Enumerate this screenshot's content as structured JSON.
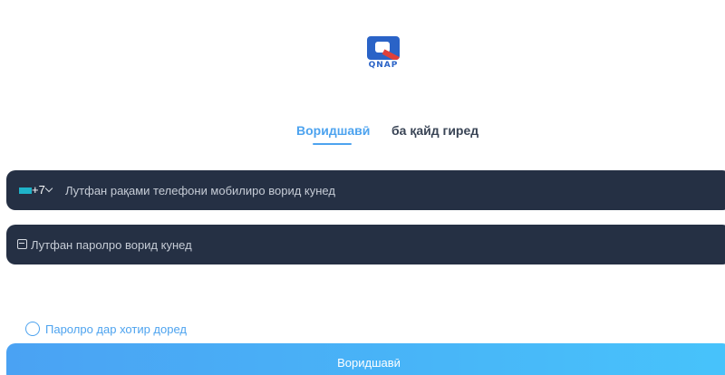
{
  "brand": {
    "logo_text": "QNAP",
    "logo_color": "#2a63c7",
    "accent_color": "#4da3ef"
  },
  "tabs": [
    {
      "label": "Воридшавӣ",
      "active": true
    },
    {
      "label": "ба қайд гиред",
      "active": false
    }
  ],
  "phone": {
    "country_code": "+7",
    "placeholder": "Лутфан рақами телефони мобилиро ворид кунед",
    "value": ""
  },
  "password": {
    "placeholder": "Лутфан паролро ворид кунед",
    "value": ""
  },
  "remember": {
    "label": "Паролро дар хотир доред",
    "checked": false
  },
  "login_button": {
    "label": "Воридшавӣ"
  }
}
